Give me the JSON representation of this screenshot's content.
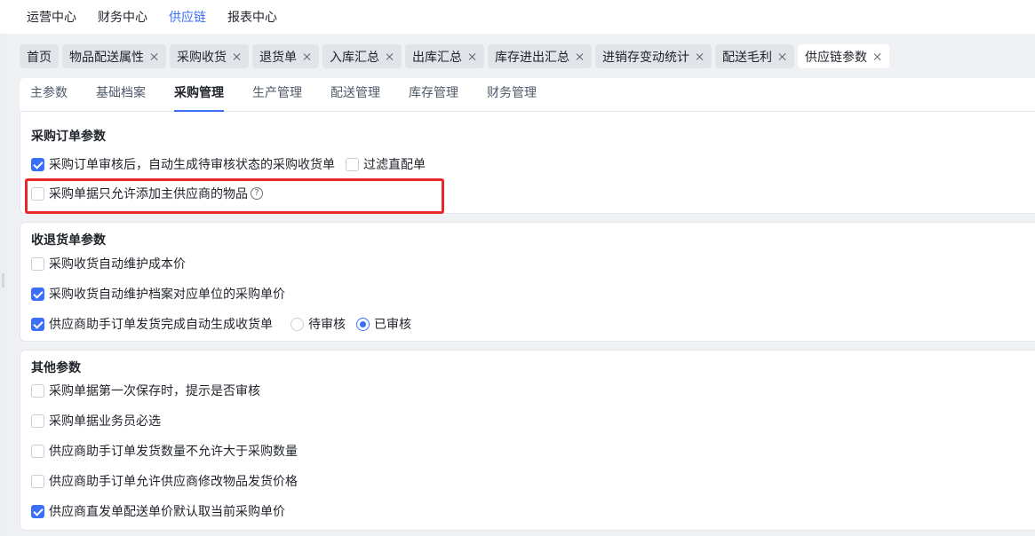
{
  "topnav": {
    "items": [
      {
        "label": "运营中心"
      },
      {
        "label": "财务中心"
      },
      {
        "label": "供应链"
      },
      {
        "label": "报表中心"
      }
    ]
  },
  "tabs": [
    {
      "label": "首页"
    },
    {
      "label": "物品配送属性"
    },
    {
      "label": "采购收货"
    },
    {
      "label": "退货单"
    },
    {
      "label": "入库汇总"
    },
    {
      "label": "出库汇总"
    },
    {
      "label": "库存进出汇总"
    },
    {
      "label": "进销存变动统计"
    },
    {
      "label": "配送毛利"
    },
    {
      "label": "供应链参数"
    }
  ],
  "subtabs": [
    {
      "label": "主参数"
    },
    {
      "label": "基础档案"
    },
    {
      "label": "采购管理"
    },
    {
      "label": "生产管理"
    },
    {
      "label": "配送管理"
    },
    {
      "label": "库存管理"
    },
    {
      "label": "财务管理"
    }
  ],
  "purchase_order": {
    "title": "采购订单参数",
    "auto_receipt": {
      "label": "采购订单审核后，自动生成待审核状态的采购收货单",
      "checked": true
    },
    "filter_direct": {
      "label": "过滤直配单",
      "checked": false
    },
    "main_supplier_only": {
      "label": "采购单据只允许添加主供应商的物品",
      "checked": false,
      "help": "?"
    }
  },
  "receipt_return": {
    "title": "收退货单参数",
    "auto_cost": {
      "label": "采购收货自动维护成本价",
      "checked": false
    },
    "auto_unit_price": {
      "label": "采购收货自动维护档案对应单位的采购单价",
      "checked": true
    },
    "supplier_auto_receipt": {
      "label": "供应商助手订单发货完成自动生成收货单",
      "checked": true
    },
    "radio_pending": {
      "label": "待审核",
      "checked": false
    },
    "radio_approved": {
      "label": "已审核",
      "checked": true
    }
  },
  "other": {
    "title": "其他参数",
    "prompt_audit": {
      "label": "采购单据第一次保存时，提示是否审核",
      "checked": false
    },
    "salesman_required": {
      "label": "采购单据业务员必选",
      "checked": false
    },
    "qty_limit": {
      "label": "供应商助手订单发货数量不允许大于采购数量",
      "checked": false
    },
    "modify_price": {
      "label": "供应商助手订单允许供应商修改物品发货价格",
      "checked": false
    },
    "direct_price": {
      "label": "供应商直发单配送单价默认取当前采购单价",
      "checked": true
    }
  },
  "colors": {
    "accent": "#3a6ff7",
    "highlight": "#e8272b"
  }
}
